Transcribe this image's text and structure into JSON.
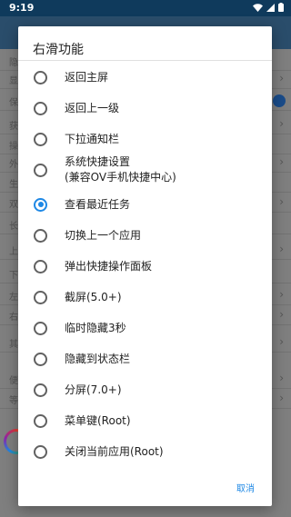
{
  "status_bar": {
    "time": "9:19",
    "icons": [
      "wifi-icon",
      "signal-icon",
      "battery-icon"
    ]
  },
  "dialog": {
    "title": "右滑功能",
    "options": [
      {
        "label": "返回主屏",
        "checked": false
      },
      {
        "label": "返回上一级",
        "checked": false
      },
      {
        "label": "下拉通知栏",
        "checked": false
      },
      {
        "label_lines": [
          "系统快捷设置",
          "(兼容OV手机快捷中心)"
        ],
        "checked": false
      },
      {
        "label": "查看最近任务",
        "checked": true
      },
      {
        "label": "切换上一个应用",
        "checked": false
      },
      {
        "label": "弹出快捷操作面板",
        "checked": false
      },
      {
        "label": "截屏(5.0+)",
        "checked": false
      },
      {
        "label": "临时隐藏3秒",
        "checked": false
      },
      {
        "label": "隐藏到状态栏",
        "checked": false
      },
      {
        "label": "分屏(7.0+)",
        "checked": false
      },
      {
        "label": "菜单键(Root)",
        "checked": false
      },
      {
        "label": "关闭当前应用(Root)",
        "checked": false
      }
    ],
    "cancel_label": "取消"
  },
  "background": {
    "row_fragments": [
      "隐",
      "显",
      "保",
      "获",
      "操",
      "外",
      "生",
      "双",
      "长",
      "上",
      "下",
      "左",
      "右",
      "其",
      "便",
      "等"
    ]
  },
  "colors": {
    "accent": "#1e88e5",
    "status_bar": "#0f3a5c"
  }
}
